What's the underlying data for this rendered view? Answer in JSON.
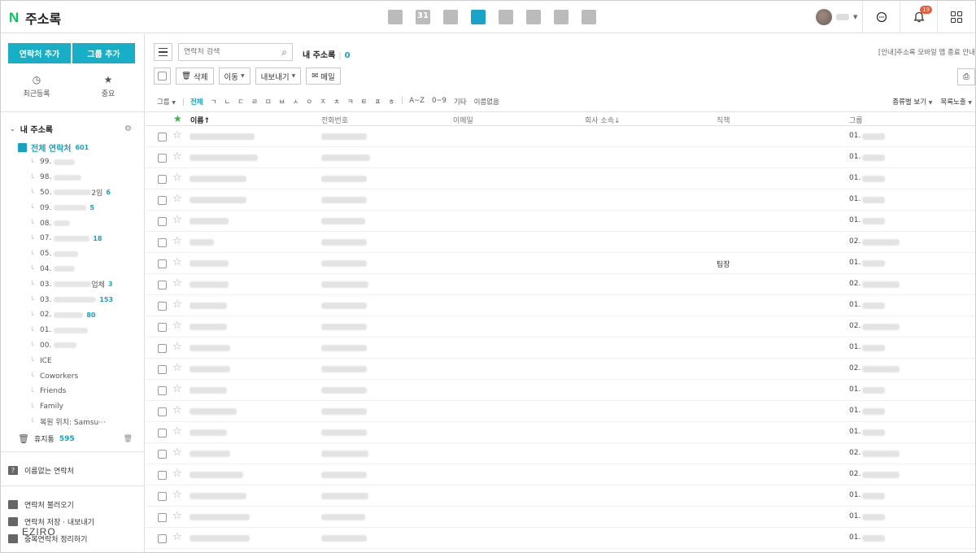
{
  "app": {
    "title": "주소록",
    "logo_letter": "N"
  },
  "top_apps": [
    {
      "name": "mail-icon",
      "glyph": "",
      "active": false
    },
    {
      "name": "calendar-icon",
      "glyph": "31",
      "active": false
    },
    {
      "name": "photo-icon",
      "glyph": "",
      "active": false
    },
    {
      "name": "contacts-icon",
      "glyph": "",
      "active": true
    },
    {
      "name": "memo-icon",
      "glyph": "",
      "active": false
    },
    {
      "name": "todo-icon",
      "glyph": "",
      "active": false
    },
    {
      "name": "home-icon",
      "glyph": "",
      "active": false
    },
    {
      "name": "bookmark-icon",
      "glyph": "",
      "active": false
    }
  ],
  "header": {
    "notification_count": "19"
  },
  "sidebar": {
    "add_contact": "연락처 추가",
    "add_group": "그룹 추가",
    "recent": "최근등록",
    "important": "중요",
    "my_addressbook": "내 주소록",
    "all_contacts": "전체 연락처",
    "all_count": "601",
    "groups": [
      {
        "prefix": "99.",
        "suffix": "",
        "count": ""
      },
      {
        "prefix": "98.",
        "suffix": "",
        "count": ""
      },
      {
        "prefix": "50.",
        "suffix": "2임",
        "count": "6"
      },
      {
        "prefix": "09.",
        "suffix": "",
        "count": "5"
      },
      {
        "prefix": "08.",
        "suffix": "",
        "count": ""
      },
      {
        "prefix": "07.",
        "suffix": "",
        "count": "18"
      },
      {
        "prefix": "05.",
        "suffix": "",
        "count": ""
      },
      {
        "prefix": "04.",
        "suffix": "",
        "count": ""
      },
      {
        "prefix": "03.",
        "suffix": "업체",
        "count": "3"
      },
      {
        "prefix": "03.",
        "suffix": "",
        "count": "153"
      },
      {
        "prefix": "02.",
        "suffix": "",
        "count": "80"
      },
      {
        "prefix": "01.",
        "suffix": "",
        "count": ""
      },
      {
        "prefix": "00.",
        "suffix": "",
        "count": ""
      },
      {
        "prefix": "ICE",
        "suffix": "",
        "count": ""
      },
      {
        "prefix": "Coworkers",
        "suffix": "",
        "count": ""
      },
      {
        "prefix": "Friends",
        "suffix": "",
        "count": ""
      },
      {
        "prefix": "Family",
        "suffix": "",
        "count": ""
      },
      {
        "prefix": "복원 위치: Samsu···",
        "suffix": "",
        "count": ""
      }
    ],
    "trash": "휴지통",
    "trash_count": "595",
    "nameless": "이름없는 연락처",
    "import": "연락처 불러오기",
    "export": "연락처 저장 · 내보내기",
    "dedupe": "중복연락처 정리하기",
    "watermark": "EZIRO"
  },
  "main": {
    "search_placeholder": "연락처 검색",
    "book_title": "내 주소록",
    "book_count": "0",
    "notice": "[안내]주소록 모바일 앱 종료 안내",
    "toolbar": {
      "delete": "삭제",
      "move": "이동",
      "export": "내보내기",
      "mail": "메일"
    },
    "filter": {
      "group": "그룹",
      "items": [
        "전체",
        "ㄱ",
        "ㄴ",
        "ㄷ",
        "ㄹ",
        "ㅁ",
        "ㅂ",
        "ㅅ",
        "ㅇ",
        "ㅈ",
        "ㅊ",
        "ㅋ",
        "ㅌ",
        "ㅍ",
        "ㅎ",
        "A~Z",
        "0~9",
        "기타",
        "이름없음"
      ],
      "view_type": "종류별 보기",
      "list_view": "목록노출"
    },
    "columns": {
      "name": "이름↑",
      "phone": "전화번호",
      "email": "이메일",
      "company": "회사 소속↓",
      "title": "직책",
      "group": "그룹"
    },
    "rows": [
      {
        "title": "",
        "group": "01."
      },
      {
        "title": "",
        "group": "01."
      },
      {
        "title": "",
        "group": "01."
      },
      {
        "title": "",
        "group": "01."
      },
      {
        "title": "",
        "group": "01."
      },
      {
        "title": "",
        "group": "02."
      },
      {
        "title": "팀장",
        "group": "01."
      },
      {
        "title": "",
        "group": "02."
      },
      {
        "title": "",
        "group": "01."
      },
      {
        "title": "",
        "group": "02."
      },
      {
        "title": "",
        "group": "01."
      },
      {
        "title": "",
        "group": "02."
      },
      {
        "title": "",
        "group": "01."
      },
      {
        "title": "",
        "group": "01."
      },
      {
        "title": "",
        "group": "01."
      },
      {
        "title": "",
        "group": "02."
      },
      {
        "title": "",
        "group": "02."
      },
      {
        "title": "",
        "group": "01."
      },
      {
        "title": "",
        "group": "01."
      },
      {
        "title": "",
        "group": "01."
      }
    ]
  }
}
